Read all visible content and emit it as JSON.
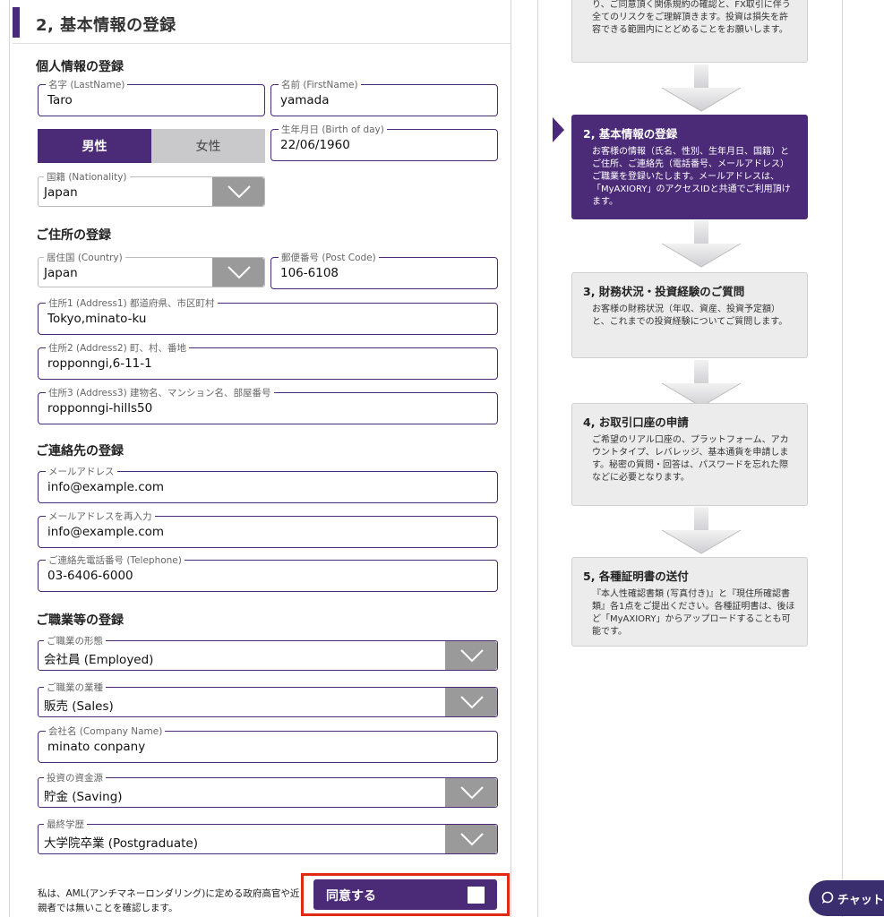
{
  "section": {
    "title": "2, 基本情報の登録"
  },
  "personal": {
    "heading": "個人情報の登録",
    "last_name": {
      "label": "名字 (LastName)",
      "value": "Taro"
    },
    "first_name": {
      "label": "名前 (FirstName)",
      "value": "yamada"
    },
    "gender": {
      "male": "男性",
      "female": "女性",
      "selected": "男性"
    },
    "birthday": {
      "label": "生年月日 (Birth of day)",
      "value": "22/06/1960"
    },
    "nationality": {
      "label": "国籍 (Nationality)",
      "value": "Japan"
    }
  },
  "address": {
    "heading": "ご住所の登録",
    "country": {
      "label": "居住国 (Country)",
      "value": "Japan"
    },
    "postcode": {
      "label": "郵便番号 (Post Code)",
      "value": "106-6108"
    },
    "address1": {
      "label": "住所1 (Address1) 都道府県、市区町村",
      "value": "Tokyo,minato-ku"
    },
    "address2": {
      "label": "住所2 (Address2) 町、村、番地",
      "value": "ropponngi,6-11-1"
    },
    "address3": {
      "label": "住所3 (Address3) 建物名、マンション名、部屋番号",
      "value": "ropponngi-hills50"
    }
  },
  "contact": {
    "heading": "ご連絡先の登録",
    "email": {
      "label": "メールアドレス",
      "value": "info@example.com"
    },
    "email_confirm": {
      "label": "メールアドレスを再入力",
      "value": "info@example.com"
    },
    "telephone": {
      "label": "ご連絡先電話番号 (Telephone)",
      "value": "03-6406-6000"
    }
  },
  "occupation": {
    "heading": "ご職業等の登録",
    "employment": {
      "label": "ご職業の形態",
      "value": "会社員 (Employed)"
    },
    "industry": {
      "label": "ご職業の業種",
      "value": "販売 (Sales)"
    },
    "company": {
      "label": "会社名 (Company Name)",
      "value": "minato conpany"
    },
    "funds": {
      "label": "投資の資金源",
      "value": "貯金 (Saving)"
    },
    "education": {
      "label": "最終学歴",
      "value": "大学院卒業 (Postgraduate)"
    }
  },
  "aml": {
    "text": "私は、AML(アンチマネーロンダリング)に定める政府高官や近親者では無いことを確認します。",
    "agree_label": "同意する",
    "checked": false
  },
  "steps": {
    "step1_desc": "り、ご同意頂く関係規約の確認と、FX取引に伴う全てのリスクをご理解頂きます。投資は損失を許容できる範囲内にとどめることをお願いします。",
    "step2": {
      "title": "2, 基本情報の登録",
      "desc": "お客様の情報（氏名、性別、生年月日、国籍）とご住所、ご連絡先（電話番号、メールアドレス）ご職業を登録いたします。メールアドレスは、「MyAXIORY」のアクセスIDと共通でご利用頂けます。"
    },
    "step3": {
      "title": "3, 財務状況・投資経験のご質問",
      "desc": "お客様の財務状況（年収、資産、投資予定額）と、これまでの投資経験についてご質問します。"
    },
    "step4": {
      "title": "4, お取引口座の申請",
      "desc": "ご希望のリアル口座の、プラットフォーム、アカウントタイプ、レバレッジ、基本通貨を申請します。秘密の質問・回答は、パスワードを忘れた際などに必要となります。"
    },
    "step5": {
      "title": "5, 各種証明書の送付",
      "desc": "『本人性確認書類 (写真付き)』と『現住所確認書類』各1点をご提出ください。各種証明書は、後ほど「MyAXIORY」からアップロードすることも可能です。"
    }
  },
  "chat": {
    "label": "チャット",
    "icon": "chat-bubble-icon"
  },
  "colors": {
    "brand": "#4b2a78",
    "highlight": "#e02a14"
  }
}
